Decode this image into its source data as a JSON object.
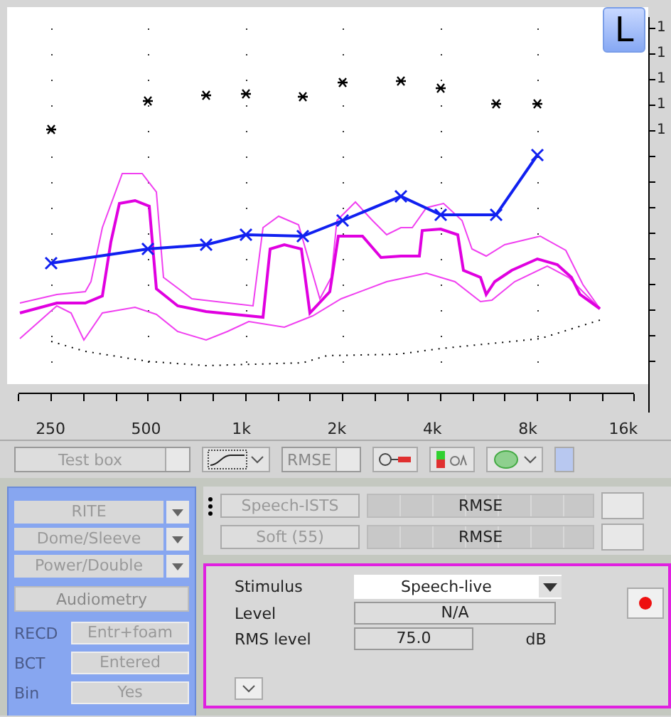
{
  "chart": {
    "side_button": "L",
    "x_labels": [
      "250",
      "500",
      "1k",
      "2k",
      "4k",
      "8k",
      "16k"
    ],
    "y_labels": [
      "1",
      "1",
      "1",
      "1",
      "1"
    ]
  },
  "toolbar": {
    "test_box": {
      "label": "Test box",
      "disabled": true
    },
    "rmse_button": "RMSE"
  },
  "fitting_panel": {
    "dropdowns": [
      {
        "value": "RITE",
        "disabled": true
      },
      {
        "value": "Dome/Sleeve",
        "disabled": true
      },
      {
        "value": "Power/Double",
        "disabled": true
      }
    ],
    "audiometry_button": "Audiometry",
    "rows": [
      {
        "label": "RECD",
        "value": "Entr+foam"
      },
      {
        "label": "BCT",
        "value": "Entered"
      },
      {
        "label": "Bin",
        "value": "Yes"
      }
    ]
  },
  "measurements": [
    {
      "stimulus": "Speech-ISTS",
      "meter": "RMSE"
    },
    {
      "stimulus": "Soft (55)",
      "meter": "RMSE"
    }
  ],
  "stimulus_panel": {
    "stimulus_label": "Stimulus",
    "stimulus_value": "Speech-live",
    "level_label": "Level",
    "level_value": "N/A",
    "rms_label": "RMS level",
    "rms_value": "75.0",
    "rms_unit": "dB"
  }
}
